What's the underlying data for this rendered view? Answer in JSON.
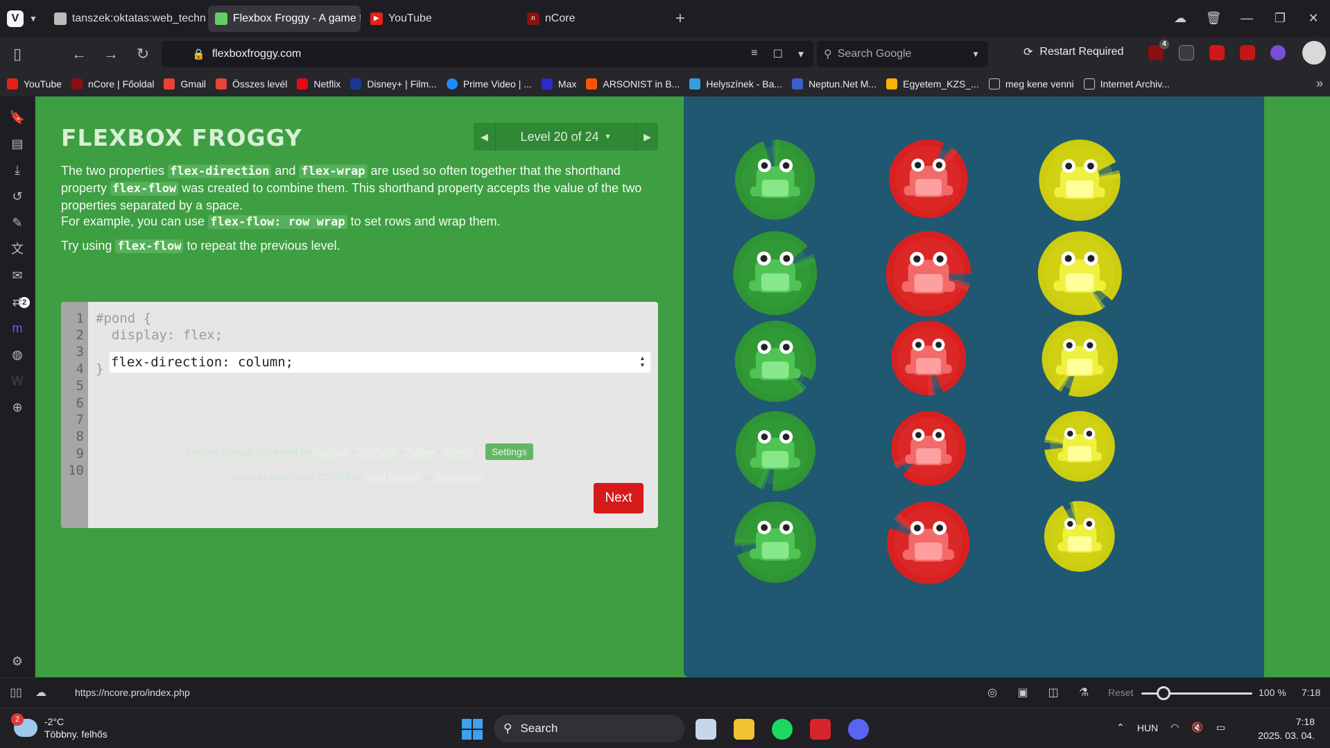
{
  "tabs": [
    {
      "label": "tanszek:oktatas:web_techno",
      "active": false
    },
    {
      "label": "Flexbox Froggy - A game fo",
      "active": true
    },
    {
      "label": "YouTube",
      "active": false
    },
    {
      "label": "nCore",
      "active": false
    }
  ],
  "address": {
    "url": "flexboxfroggy.com",
    "search_placeholder": "Search Google",
    "restart_label": "Restart Required",
    "ext_badge": "4"
  },
  "bookmarks": [
    {
      "label": "YouTube",
      "color": "#e62117"
    },
    {
      "label": "nCore | Főoldal",
      "color": "#8b1010"
    },
    {
      "label": "Gmail",
      "color": "#ea4335"
    },
    {
      "label": "Összes levél",
      "color": "#ea4335"
    },
    {
      "label": "Netflix",
      "color": "#e50914"
    },
    {
      "label": "Disney+ | Film...",
      "color": "#1a3a8f"
    },
    {
      "label": "Prime Video | ...",
      "color": "#1a8cff"
    },
    {
      "label": "Max",
      "color": "#2c2cc8"
    },
    {
      "label": "ARSONIST in B...",
      "color": "#ff5500"
    },
    {
      "label": "Helyszínek - Ba...",
      "color": "#35a0e0"
    },
    {
      "label": "Neptun.Net M...",
      "color": "#3a5fcd"
    },
    {
      "label": "Egyetem_KZS_...",
      "color": "#f4b400"
    },
    {
      "label": "meg kene venni",
      "color": "#26262b"
    },
    {
      "label": "Internet Archiv...",
      "color": "#26262b"
    }
  ],
  "sidebar": {
    "badge": "2"
  },
  "game": {
    "title": "FLEXBOX FROGGY",
    "level_label": "Level 20 of 24",
    "paragraph1": {
      "t1": "The two properties ",
      "c1": "flex-direction",
      "t2": " and ",
      "c2": "flex-wrap",
      "t3": " are used so often together that the shorthand property ",
      "c3": "flex-flow",
      "t4": " was created to combine them. This shorthand property accepts the value of the two properties separated by a space."
    },
    "paragraph2": {
      "t1": "For example, you can use ",
      "c1": "flex-flow: row wrap",
      "t2": " to set rows and wrap them."
    },
    "paragraph3": {
      "t1": "Try using ",
      "c1": "flex-flow",
      "t2": " to repeat the previous level."
    },
    "editor": {
      "line_numbers": [
        "1",
        "2",
        "3",
        "4",
        "5",
        "6",
        "7",
        "8",
        "9",
        "10"
      ],
      "line1": "#pond {",
      "line2": "  display: flex;",
      "input_value": "flex-direction: column;",
      "line4": "}",
      "next_label": "Next"
    },
    "credits": {
      "prefix": "Flexbox Froggy is created by ",
      "codepip": "Codepip",
      "youtube": "YouTube",
      "twitter": "Twitter",
      "github": "GitHub",
      "settings": "Settings",
      "sep": " • "
    },
    "more": {
      "prefix": "Want to learn more CSS? Play ",
      "grid": "Grid Garden",
      "mid": " or ",
      "anchor": "Anchoreum",
      "suffix": "."
    },
    "colors": {
      "green": "#2f9434",
      "red": "#d92020",
      "yellow": "#cccc10",
      "pond": "#1f5870"
    }
  },
  "statusbar": {
    "link_url": "https://ncore.pro/index.php",
    "reset_label": "Reset",
    "zoom_label": "100 %",
    "zoom_level_percent": 100,
    "time": "7:18"
  },
  "taskbar": {
    "weather_temp": "-2°C",
    "weather_desc": "Többny. felhős",
    "weather_badge": "2",
    "search_label": "Search",
    "lang": "HUN",
    "time": "7:18",
    "date": "2025. 03. 04."
  }
}
